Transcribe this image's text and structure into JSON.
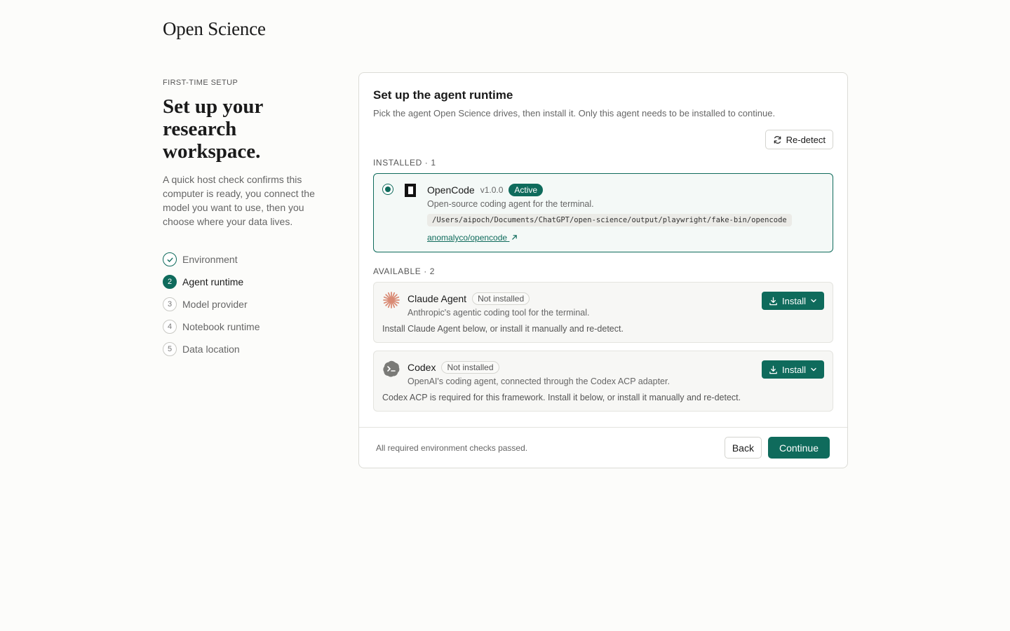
{
  "app": {
    "brand": "Open Science"
  },
  "intro": {
    "eyebrow": "FIRST-TIME SETUP",
    "headline": "Set up your research workspace.",
    "lede": "A quick host check confirms this computer is ready, you connect the model you want to use, then you choose where your data lives."
  },
  "steps": [
    {
      "marker": "",
      "label": "Environment",
      "state": "done"
    },
    {
      "marker": "2",
      "label": "Agent runtime",
      "state": "active"
    },
    {
      "marker": "3",
      "label": "Model provider",
      "state": "pending"
    },
    {
      "marker": "4",
      "label": "Notebook runtime",
      "state": "pending"
    },
    {
      "marker": "5",
      "label": "Data location",
      "state": "pending"
    }
  ],
  "card": {
    "title": "Set up the agent runtime",
    "subtitle": "Pick the agent Open Science drives, then install it. Only this agent needs to be installed to continue.",
    "redetect_label": "Re-detect",
    "installed_label": "INSTALLED · 1",
    "available_label": "AVAILABLE · 2",
    "installed": {
      "name": "OpenCode",
      "version": "v1.0.0",
      "badge": "Active",
      "description": "Open-source coding agent for the terminal.",
      "path": "/Users/aipoch/Documents/ChatGPT/open-science/output/playwright/fake-bin/opencode",
      "repo": "anomalyco/opencode",
      "icon": "opencode-logo-icon"
    },
    "available": [
      {
        "name": "Claude Agent",
        "badge": "Not installed",
        "description": "Anthropic's agentic coding tool for the terminal.",
        "note": "Install Claude Agent below, or install it manually and re-detect.",
        "install_label": "Install",
        "icon": "claude-starburst-icon"
      },
      {
        "name": "Codex",
        "badge": "Not installed",
        "description": "OpenAI's coding agent, connected through the Codex ACP adapter.",
        "note": "Codex ACP is required for this framework. Install it below, or install it manually and re-detect.",
        "install_label": "Install",
        "icon": "codex-terminal-icon"
      }
    ],
    "footer": {
      "status": "All required environment checks passed.",
      "back_label": "Back",
      "continue_label": "Continue"
    }
  },
  "colors": {
    "accent": "#0f6b5c",
    "claude": "#d98a74",
    "background": "#fcfcfa"
  }
}
